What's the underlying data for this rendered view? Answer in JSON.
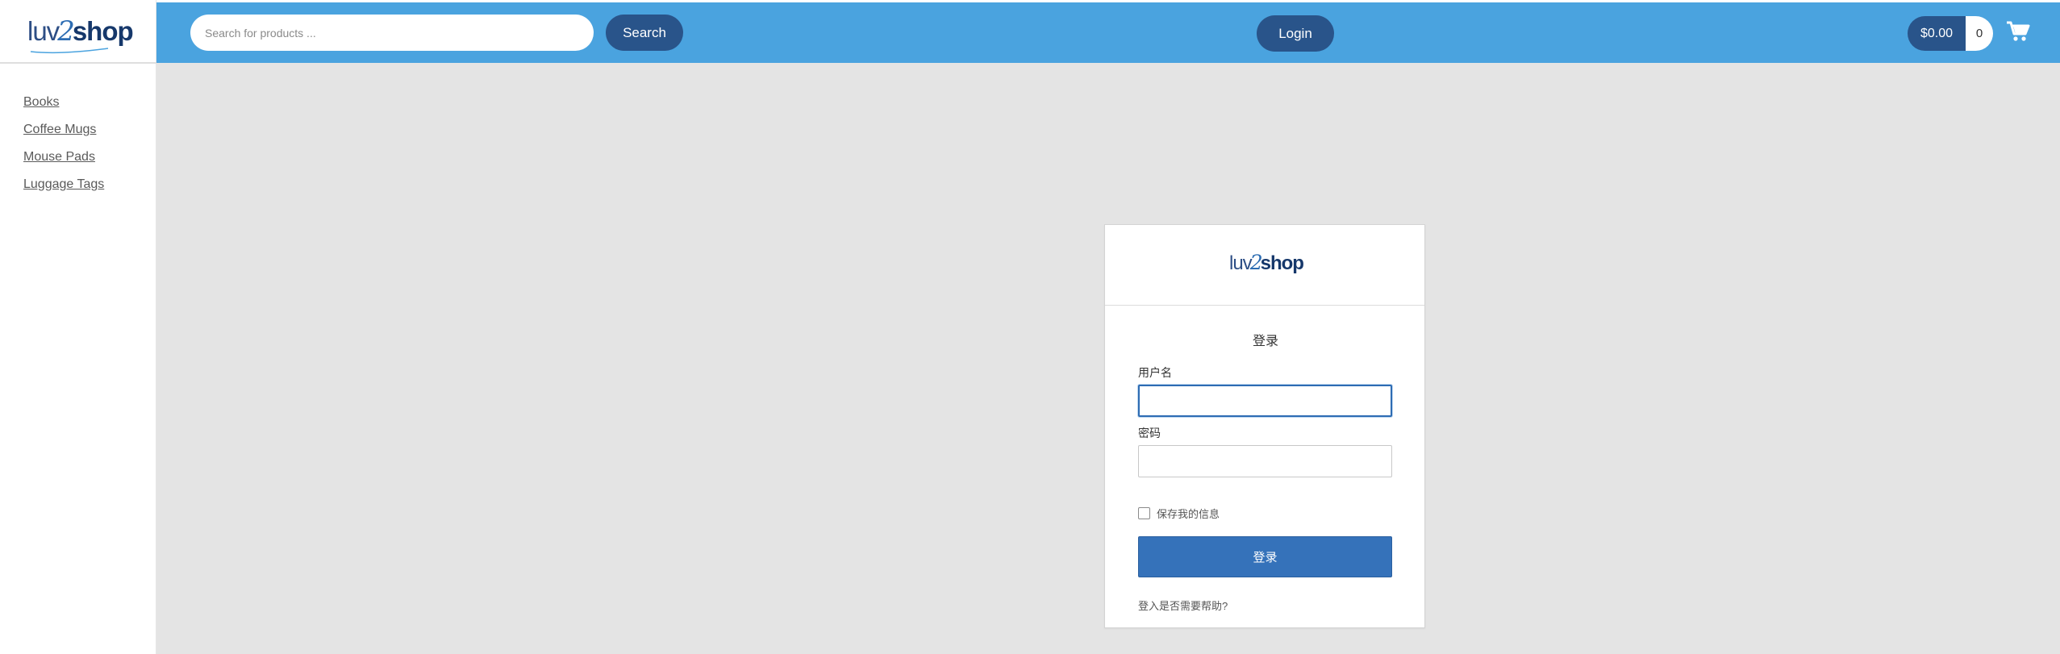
{
  "brand": {
    "logo_part1": "luv",
    "logo_part2": "2",
    "logo_part3": "shop"
  },
  "header": {
    "search_placeholder": "Search for products ...",
    "search_label": "Search",
    "login_label": "Login",
    "cart_total": "$0.00",
    "cart_count": "0",
    "cart_icon": "shopping-cart-icon",
    "bar_color": "#4aa3df",
    "button_color": "#29548a"
  },
  "sidebar": {
    "items": [
      {
        "label": "Books"
      },
      {
        "label": "Coffee Mugs"
      },
      {
        "label": "Mouse Pads"
      },
      {
        "label": "Luggage Tags"
      }
    ]
  },
  "login_card": {
    "title": "登录",
    "username_label": "用户名",
    "username_value": "",
    "password_label": "密码",
    "password_value": "",
    "remember_label": "保存我的信息",
    "remember_checked": false,
    "submit_label": "登录",
    "help_link": "登入是否需要帮助?",
    "accent_color": "#3572ba"
  }
}
